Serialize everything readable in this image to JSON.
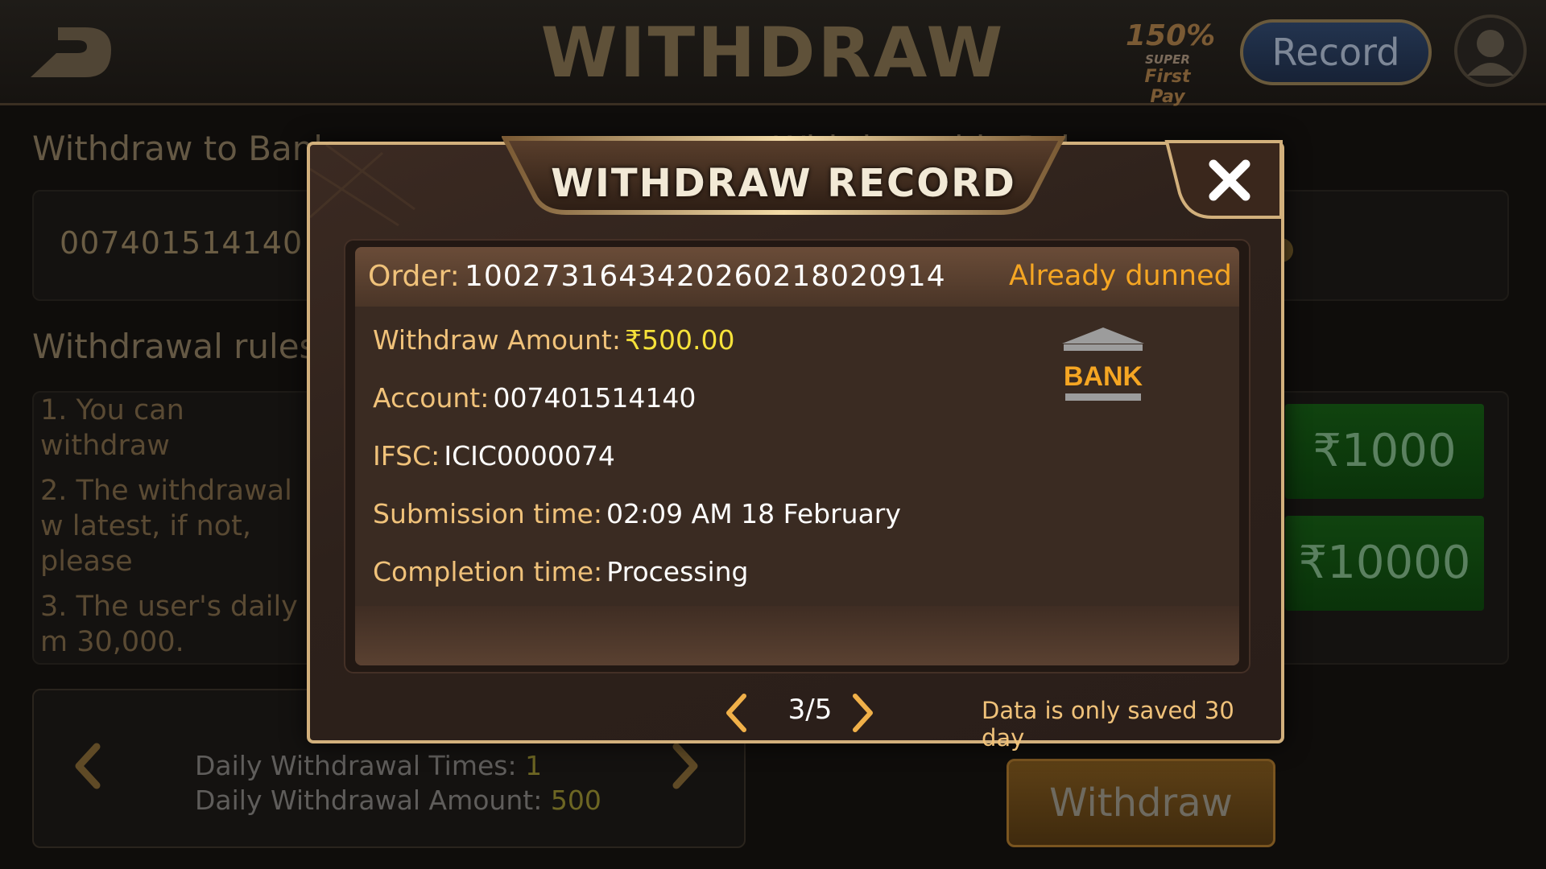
{
  "header": {
    "title": "WITHDRAW",
    "promo": {
      "percent": "150%",
      "line1": "SUPER",
      "line2": "First Pay"
    },
    "record_label": "Record"
  },
  "background": {
    "bank_label": "Withdraw to Bank",
    "balance_label_partial": "Withdrawable Bal",
    "account_number": "007401514140",
    "rules_title": "Withdrawal rules",
    "rules": [
      "1. You can withdraw",
      "2. The withdrawal w latest, if not, please",
      "3. The user's daily m 30,000."
    ],
    "daily_times_label": "Daily Withdrawal Times:",
    "daily_times_value": "1",
    "daily_amount_label": "Daily Withdrawal Amount:",
    "daily_amount_value": "500",
    "amount_options": [
      "₹1000",
      "₹10000"
    ],
    "withdraw_label": "Withdraw"
  },
  "modal": {
    "title": "WITHDRAW RECORD",
    "order_label": "Order:",
    "order_number": "1002731643420260218020914",
    "status": "Already dunned",
    "withdraw_amount_label": "Withdraw Amount:",
    "withdraw_amount": "₹500.00",
    "account_label": "Account:",
    "account": "007401514140",
    "ifsc_label": "IFSC:",
    "ifsc": "ICIC0000074",
    "submission_label": "Submission time:",
    "submission_time": "02:09 AM 18 February",
    "completion_label": "Completion time:",
    "completion_time": "Processing",
    "bank_icon_text": "BANK",
    "page": "3/5",
    "note": "Data is only saved 30 day"
  },
  "icons": {
    "back": "back-arrow-icon",
    "close": "close-icon",
    "prev": "chevron-left-icon",
    "next": "chevron-right-icon",
    "bank": "bank-icon",
    "avatar": "user-avatar-icon"
  },
  "colors": {
    "gold_label": "#f0c27a",
    "status_orange": "#f5a623",
    "amount_yellow": "#f6e23a",
    "modal_border": "#d2b07c"
  }
}
